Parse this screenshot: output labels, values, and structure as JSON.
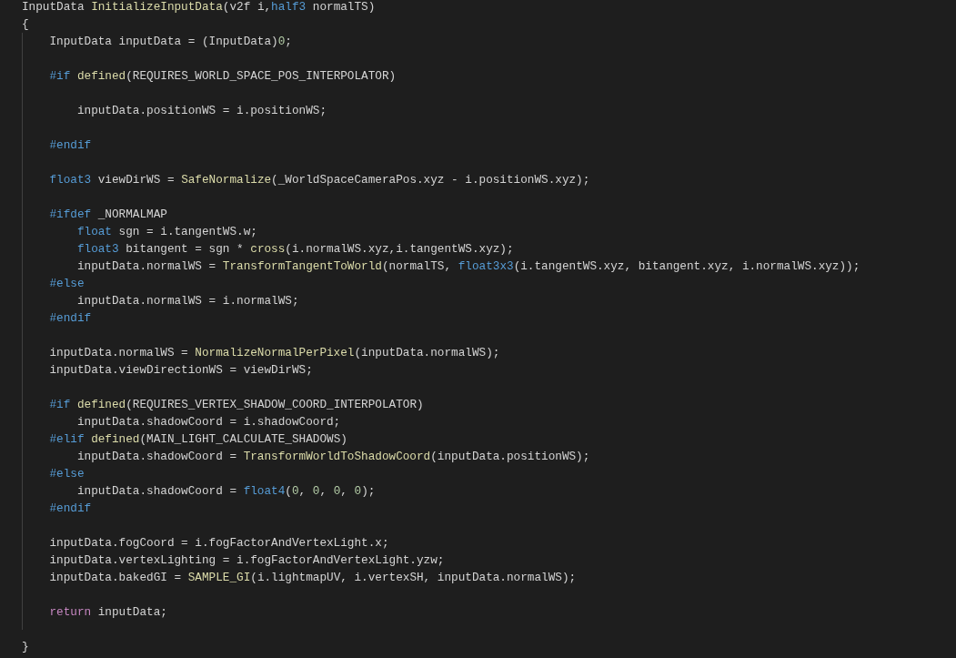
{
  "editor": {
    "lines": [
      {
        "kind": "code",
        "tokens": [
          {
            "kind": "plain",
            "text": "InputData "
          },
          {
            "kind": "function",
            "text": "InitializeInputData"
          },
          {
            "kind": "plain",
            "text": "(v2f i,"
          },
          {
            "kind": "type",
            "text": "half3"
          },
          {
            "kind": "plain",
            "text": " normalTS)"
          }
        ]
      },
      {
        "kind": "code",
        "tokens": [
          {
            "kind": "plain",
            "text": "{"
          }
        ]
      },
      {
        "kind": "code",
        "tokens": [
          {
            "kind": "plain",
            "text": "    InputData inputData = (InputData)"
          },
          {
            "kind": "number",
            "text": "0"
          },
          {
            "kind": "plain",
            "text": ";"
          }
        ]
      },
      {
        "kind": "blank"
      },
      {
        "kind": "code",
        "tokens": [
          {
            "kind": "directive",
            "text": "    #if"
          },
          {
            "kind": "function",
            "text": " defined"
          },
          {
            "kind": "plain",
            "text": "(REQUIRES_WORLD_SPACE_POS_INTERPOLATOR)"
          }
        ]
      },
      {
        "kind": "blank"
      },
      {
        "kind": "code",
        "tokens": [
          {
            "kind": "plain",
            "text": "        inputData.positionWS = i.positionWS;"
          }
        ]
      },
      {
        "kind": "blank"
      },
      {
        "kind": "code",
        "tokens": [
          {
            "kind": "directive",
            "text": "    #endif"
          }
        ]
      },
      {
        "kind": "blank"
      },
      {
        "kind": "code",
        "tokens": [
          {
            "kind": "type",
            "text": "    float3"
          },
          {
            "kind": "plain",
            "text": " viewDirWS = "
          },
          {
            "kind": "function",
            "text": "SafeNormalize"
          },
          {
            "kind": "plain",
            "text": "(_WorldSpaceCameraPos.xyz - i.positionWS.xyz);"
          }
        ]
      },
      {
        "kind": "blank"
      },
      {
        "kind": "code",
        "tokens": [
          {
            "kind": "directive",
            "text": "    #ifdef"
          },
          {
            "kind": "plain",
            "text": " _NORMALMAP"
          }
        ]
      },
      {
        "kind": "code",
        "tokens": [
          {
            "kind": "type",
            "text": "        float"
          },
          {
            "kind": "plain",
            "text": " sgn = i.tangentWS.w;"
          }
        ]
      },
      {
        "kind": "code",
        "tokens": [
          {
            "kind": "type",
            "text": "        float3"
          },
          {
            "kind": "plain",
            "text": " bitangent = sgn * "
          },
          {
            "kind": "function",
            "text": "cross"
          },
          {
            "kind": "plain",
            "text": "(i.normalWS.xyz,i.tangentWS.xyz);"
          }
        ]
      },
      {
        "kind": "code",
        "tokens": [
          {
            "kind": "plain",
            "text": "        inputData.normalWS = "
          },
          {
            "kind": "function",
            "text": "TransformTangentToWorld"
          },
          {
            "kind": "plain",
            "text": "(normalTS, "
          },
          {
            "kind": "type",
            "text": "float3x3"
          },
          {
            "kind": "plain",
            "text": "(i.tangentWS.xyz, bitangent.xyz, i.normalWS.xyz));"
          }
        ]
      },
      {
        "kind": "code",
        "tokens": [
          {
            "kind": "directive",
            "text": "    #else"
          }
        ]
      },
      {
        "kind": "code",
        "tokens": [
          {
            "kind": "plain",
            "text": "        inputData.normalWS = i.normalWS;"
          }
        ]
      },
      {
        "kind": "code",
        "tokens": [
          {
            "kind": "directive",
            "text": "    #endif"
          }
        ]
      },
      {
        "kind": "blank"
      },
      {
        "kind": "code",
        "tokens": [
          {
            "kind": "plain",
            "text": "    inputData.normalWS = "
          },
          {
            "kind": "function",
            "text": "NormalizeNormalPerPixel"
          },
          {
            "kind": "plain",
            "text": "(inputData.normalWS);"
          }
        ]
      },
      {
        "kind": "code",
        "tokens": [
          {
            "kind": "plain",
            "text": "    inputData.viewDirectionWS = viewDirWS;"
          }
        ]
      },
      {
        "kind": "blank"
      },
      {
        "kind": "code",
        "tokens": [
          {
            "kind": "directive",
            "text": "    #if"
          },
          {
            "kind": "function",
            "text": " defined"
          },
          {
            "kind": "plain",
            "text": "(REQUIRES_VERTEX_SHADOW_COORD_INTERPOLATOR)"
          }
        ]
      },
      {
        "kind": "code",
        "tokens": [
          {
            "kind": "plain",
            "text": "        inputData.shadowCoord = i.shadowCoord;"
          }
        ]
      },
      {
        "kind": "code",
        "tokens": [
          {
            "kind": "directive",
            "text": "    #elif"
          },
          {
            "kind": "function",
            "text": " defined"
          },
          {
            "kind": "plain",
            "text": "(MAIN_LIGHT_CALCULATE_SHADOWS)"
          }
        ]
      },
      {
        "kind": "code",
        "tokens": [
          {
            "kind": "plain",
            "text": "        inputData.shadowCoord = "
          },
          {
            "kind": "function",
            "text": "TransformWorldToShadowCoord"
          },
          {
            "kind": "plain",
            "text": "(inputData.positionWS);"
          }
        ]
      },
      {
        "kind": "code",
        "tokens": [
          {
            "kind": "directive",
            "text": "    #else"
          }
        ]
      },
      {
        "kind": "code",
        "tokens": [
          {
            "kind": "plain",
            "text": "        inputData.shadowCoord = "
          },
          {
            "kind": "type",
            "text": "float4"
          },
          {
            "kind": "plain",
            "text": "("
          },
          {
            "kind": "number",
            "text": "0"
          },
          {
            "kind": "plain",
            "text": ", "
          },
          {
            "kind": "number",
            "text": "0"
          },
          {
            "kind": "plain",
            "text": ", "
          },
          {
            "kind": "number",
            "text": "0"
          },
          {
            "kind": "plain",
            "text": ", "
          },
          {
            "kind": "number",
            "text": "0"
          },
          {
            "kind": "plain",
            "text": ");"
          }
        ]
      },
      {
        "kind": "code",
        "tokens": [
          {
            "kind": "directive",
            "text": "    #endif"
          }
        ]
      },
      {
        "kind": "blank"
      },
      {
        "kind": "code",
        "tokens": [
          {
            "kind": "plain",
            "text": "    inputData.fogCoord = i.fogFactorAndVertexLight.x;"
          }
        ]
      },
      {
        "kind": "code",
        "tokens": [
          {
            "kind": "plain",
            "text": "    inputData.vertexLighting = i.fogFactorAndVertexLight.yzw;"
          }
        ]
      },
      {
        "kind": "code",
        "tokens": [
          {
            "kind": "plain",
            "text": "    inputData.bakedGI = "
          },
          {
            "kind": "function",
            "text": "SAMPLE_GI"
          },
          {
            "kind": "plain",
            "text": "(i.lightmapUV, i.vertexSH, inputData.normalWS);"
          }
        ]
      },
      {
        "kind": "blank"
      },
      {
        "kind": "code",
        "tokens": [
          {
            "kind": "control",
            "text": "    return"
          },
          {
            "kind": "plain",
            "text": " inputData;"
          }
        ]
      },
      {
        "kind": "blank"
      },
      {
        "kind": "code",
        "tokens": [
          {
            "kind": "plain",
            "text": "}"
          }
        ]
      }
    ]
  }
}
